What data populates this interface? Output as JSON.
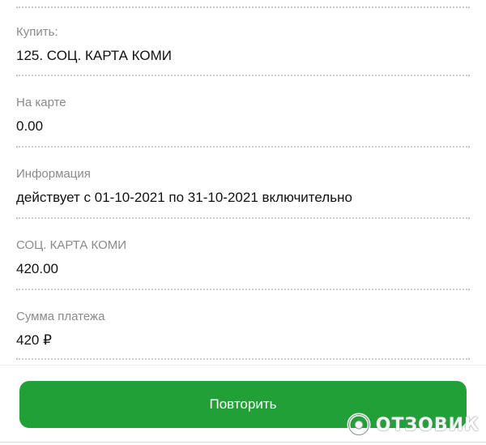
{
  "fields": [
    {
      "label": "Купить:",
      "value": "125. СОЦ. КАРТА КОМИ"
    },
    {
      "label": "На карте",
      "value": "0.00"
    },
    {
      "label": "Информация",
      "value": "действует с 01-10-2021 по 31-10-2021 включительно"
    },
    {
      "label": "СОЦ. КАРТА КОМИ",
      "value": "420.00"
    },
    {
      "label": "Сумма платежа",
      "value": "420 ₽"
    }
  ],
  "actions": {
    "repeat_label": "Повторить"
  },
  "watermark": {
    "text": "ОТЗОВИК",
    "icon": "otzovik-logo-icon"
  },
  "colors": {
    "accent": "#21a038",
    "label": "#8a8a8a",
    "text": "#111111"
  }
}
